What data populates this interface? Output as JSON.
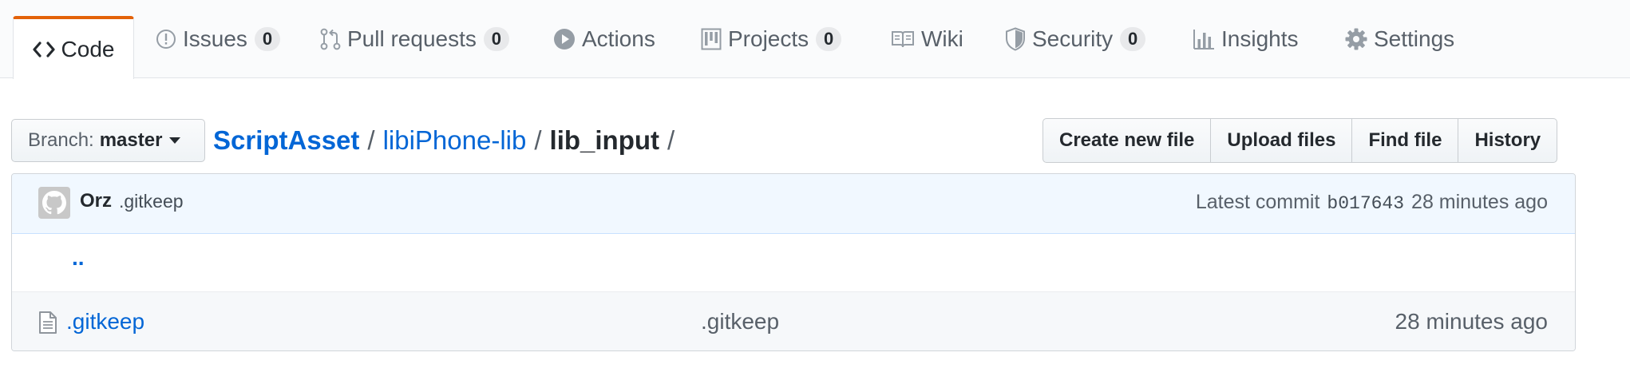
{
  "colors": {
    "accent_tab_border": "#e36209",
    "link": "#0366d6",
    "text": "#24292e",
    "muted": "#586069",
    "commit_bg": "#f1f8ff"
  },
  "tabs": [
    {
      "label": "Code",
      "icon": "code-icon",
      "selected": true
    },
    {
      "label": "Issues",
      "icon": "issue-opened-icon",
      "count": "0"
    },
    {
      "label": "Pull requests",
      "icon": "git-pull-request-icon",
      "count": "0"
    },
    {
      "label": "Actions",
      "icon": "play-icon"
    },
    {
      "label": "Projects",
      "icon": "project-icon",
      "count": "0"
    },
    {
      "label": "Wiki",
      "icon": "book-icon"
    },
    {
      "label": "Security",
      "icon": "shield-icon",
      "count": "0"
    },
    {
      "label": "Insights",
      "icon": "graph-icon"
    },
    {
      "label": "Settings",
      "icon": "gear-icon"
    }
  ],
  "branch": {
    "label": "Branch:",
    "value": "master"
  },
  "breadcrumb": {
    "owner": "ScriptAsset",
    "repo": "libiPhone-lib",
    "current": "lib_input",
    "separator": "/"
  },
  "file_actions": [
    "Create new file",
    "Upload files",
    "Find file",
    "History"
  ],
  "latest_commit": {
    "author": "Orz",
    "message": ".gitkeep",
    "label": "Latest commit",
    "sha": "b017643",
    "age": "28 minutes ago"
  },
  "parent_dir_link": "..",
  "files": [
    {
      "icon": "file-icon",
      "name": ".gitkeep",
      "message": ".gitkeep",
      "age": "28 minutes ago"
    }
  ]
}
